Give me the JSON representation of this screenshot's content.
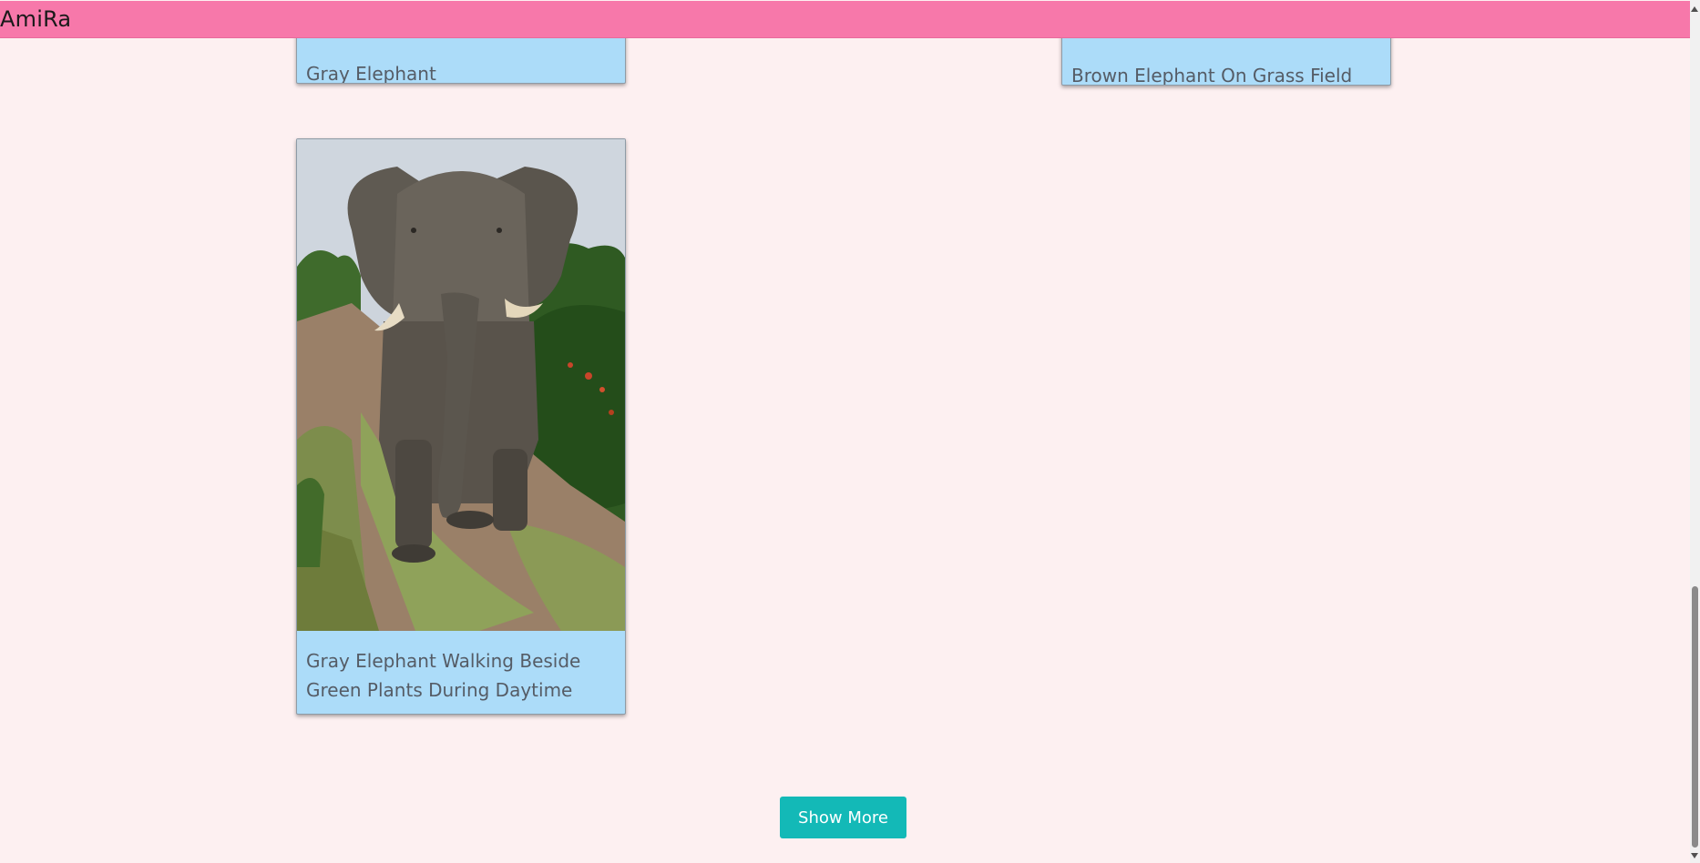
{
  "header": {
    "brand": "AmiRa"
  },
  "gallery": {
    "cards": [
      {
        "caption": "Gray Elephant"
      },
      {
        "caption": "Brown Elephant On Grass Field"
      },
      {
        "caption": "Gray Elephant Walking Beside Green Plants During Daytime"
      }
    ]
  },
  "actions": {
    "show_more_label": "Show More"
  },
  "colors": {
    "header_bg": "#f778aa",
    "page_bg": "#fdf0f1",
    "card_bg": "#acdcf9",
    "button_bg": "#13b9b7"
  }
}
